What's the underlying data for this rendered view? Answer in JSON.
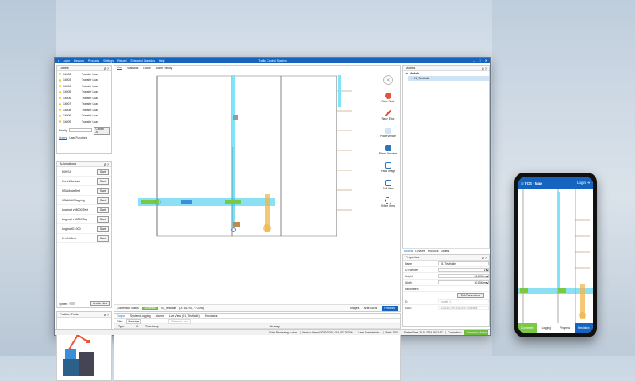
{
  "window": {
    "title": "Traffic Control System",
    "menu": [
      "Login",
      "Devices",
      "Products",
      "Settings",
      "Reload",
      "Extended Statistics",
      "Help"
    ]
  },
  "orders": {
    "title": "Orders",
    "rows": [
      {
        "id": "16002",
        "type": "Transfer Load"
      },
      {
        "id": "16003",
        "type": "Transfer Load"
      },
      {
        "id": "16004",
        "type": "Transfer Load"
      },
      {
        "id": "16005",
        "type": "Transfer Load"
      },
      {
        "id": "16006",
        "type": "Transfer Load"
      },
      {
        "id": "16007",
        "type": "Transfer Load"
      },
      {
        "id": "16008",
        "type": "Transfer Load"
      },
      {
        "id": "16009",
        "type": "Transfer Load"
      },
      {
        "id": "16009",
        "type": "Transfer Load"
      }
    ],
    "priority_label": "Priority",
    "cancel_all": "Cancel All",
    "tabs": [
      "Orders",
      "User Functions"
    ]
  },
  "automations": {
    "title": "Automations",
    "start_label": "Start",
    "rows": [
      "FillHSA",
      "PurchBlankset",
      "HSAModeTest",
      "HSAMultiMapping",
      "Logimat v98000 Test",
      "Logimat v98000 Tag",
      "LogimatG1000",
      "ProTekTest"
    ],
    "system_label": "System",
    "create_new": "Create New"
  },
  "position_finder": {
    "title": "Position Finder"
  },
  "center": {
    "tabs": [
      "Map",
      "Statistics",
      "Editor",
      "Alarm History"
    ],
    "tools": [
      "Place Node",
      "Place Edge",
      "Place Vehicle",
      "Place Structure",
      "Place Image",
      "Edit Item",
      "Select Items"
    ],
    "connection_label": "Connection Status",
    "connection_value": "Connected",
    "model_name": "01_Testhalle",
    "coords": "(X: 16.794, Y: 0.096)",
    "images_label": "Images",
    "area_locks": "Area Locks",
    "positions": "Positions"
  },
  "output": {
    "tabs": [
      "Output",
      "System Logging",
      "Alarms",
      "Live View (01_Testhalle)",
      "Simulation"
    ],
    "filter": [
      "Filter",
      "Message"
    ],
    "release_lock": "Release Lock",
    "columns": [
      "Type",
      "ID",
      "Timestamp",
      "Message"
    ],
    "rows": [
      {
        "type": "Information",
        "id": "1",
        "timestamp": "10/29/2024 04:08:43 AM",
        "message": "Authorization: User Administrator successfully signed in"
      }
    ]
  },
  "models": {
    "title": "Models",
    "root": "Models",
    "item": "01_Testhalle",
    "tabs": [
      "Models",
      "Devices",
      "Products",
      "Orders"
    ]
  },
  "properties": {
    "title": "Properties",
    "rows": [
      {
        "k": "Name",
        "v": "01_Testhalle"
      },
      {
        "k": "ID Number",
        "v": "1"
      },
      {
        "k": "Height",
        "v": "40,205 m"
      },
      {
        "k": "Width",
        "v": "30,856 m"
      }
    ],
    "params_label": "Parameters",
    "edit_params": "Edit Parameters",
    "ro_rows": [
      {
        "k": "ID",
        "v": "model_1"
      },
      {
        "k": "GUID",
        "v": "5fa0d402-c75f-4f91-a372-7bd5908d8"
      }
    ]
  },
  "statusbar": [
    "Order Processing: Active",
    "Version: Kernel V02.03.000, GUI V02.20.000",
    "User: Administrator",
    "Rank: 1000",
    "SystemTime: 29.10.2024 08:52:17",
    "Connection:",
    "Connection Active"
  ],
  "phone": {
    "title": "TCS - Map",
    "login": "Login",
    "footer": [
      "Connected",
      "Logging",
      "Progress",
      "Simulation"
    ]
  },
  "colors": {
    "accent": "#1565c0",
    "ok": "#6dbf3a",
    "cyan": "#2ec6ea",
    "orange": "#f0b54a",
    "green": "#7ac943"
  }
}
